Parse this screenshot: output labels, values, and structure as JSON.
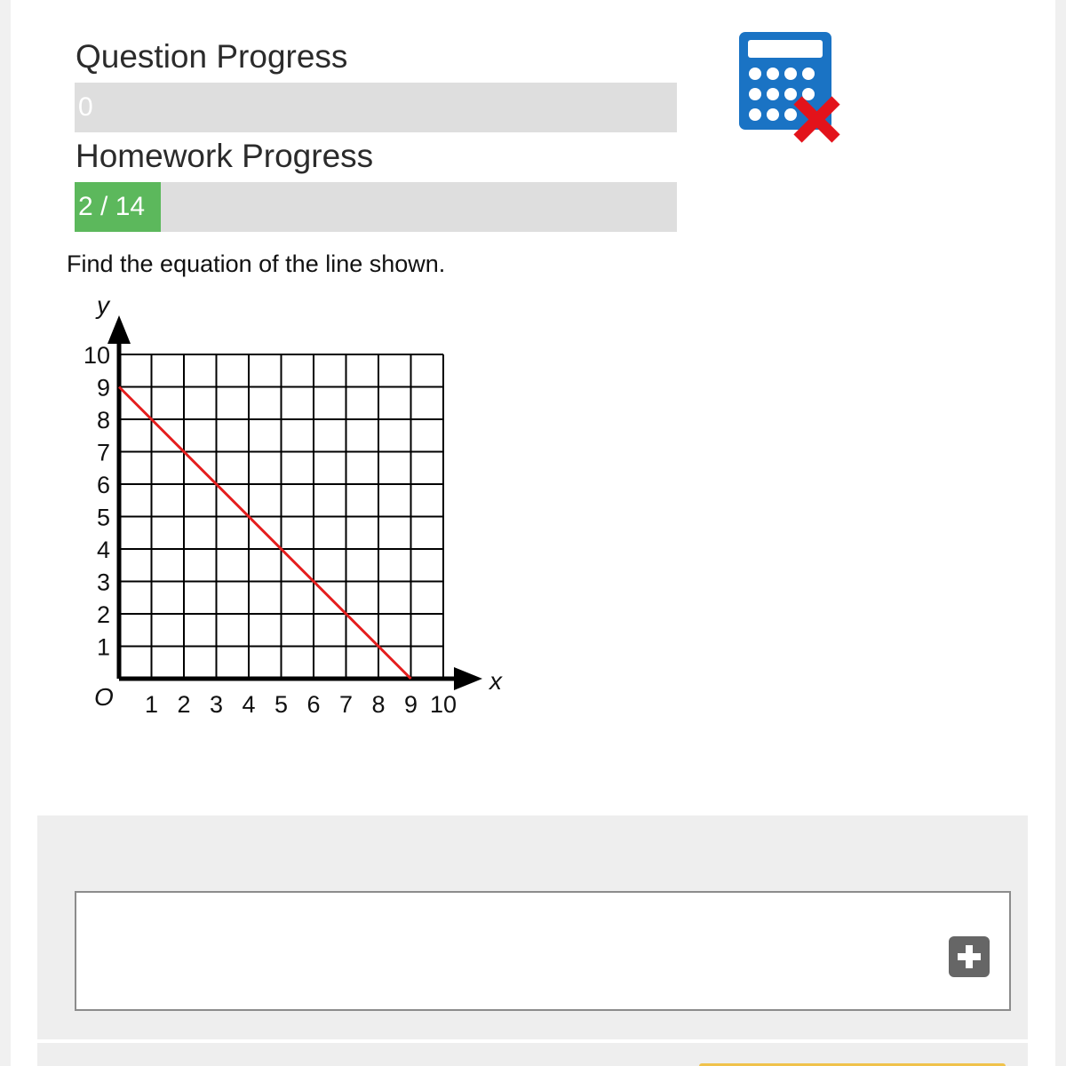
{
  "question_progress": {
    "label": "Question Progress",
    "value_text": "0",
    "fraction": 0
  },
  "homework_progress": {
    "label": "Homework Progress",
    "value_text": "2 / 14",
    "fraction": 0.143
  },
  "calculator_icon": {
    "name": "calculator-not-allowed-icon",
    "color": "#1a73c4",
    "cross_color": "#e3131b"
  },
  "question": {
    "text": "Find the equation of the line shown."
  },
  "chart_data": {
    "type": "line",
    "xlabel": "x",
    "ylabel": "y",
    "origin_label": "O",
    "xlim": [
      0,
      10
    ],
    "ylim": [
      0,
      10
    ],
    "x_ticks": [
      "1",
      "2",
      "3",
      "4",
      "5",
      "6",
      "7",
      "8",
      "9",
      "10"
    ],
    "y_ticks": [
      "1",
      "2",
      "3",
      "4",
      "5",
      "6",
      "7",
      "8",
      "9",
      "10"
    ],
    "grid": true,
    "series": [
      {
        "x": [
          0,
          9
        ],
        "y": [
          9,
          0
        ],
        "color": "#e41e1e"
      }
    ]
  },
  "answer": {
    "value": "",
    "add_button_icon": "plus-icon"
  }
}
